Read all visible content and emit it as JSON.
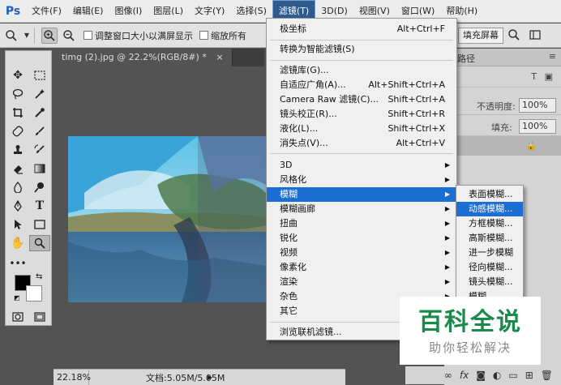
{
  "app": {
    "logo": "Ps"
  },
  "menubar": {
    "items": [
      "文件(F)",
      "编辑(E)",
      "图像(I)",
      "图层(L)",
      "文字(Y)",
      "选择(S)",
      "滤镜(T)",
      "3D(D)",
      "视图(V)",
      "窗口(W)",
      "帮助(H)"
    ],
    "active_index": 6
  },
  "options": {
    "resize_windows_label": "调整窗口大小以满屏显示",
    "zoom_all_label": "缩放所有",
    "fill_screen_label": "填充屏幕"
  },
  "document": {
    "tab_title": "timg (2).jpg @ 22.2%(RGB/8#) *",
    "tab_close": "×"
  },
  "status": {
    "zoom": "22.18%",
    "doc_size": "文档:5.05M/5.05M"
  },
  "right_panel": {
    "tab_label": "路径",
    "opacity_label": "不透明度:",
    "opacity_value": "100%",
    "fill_label": "填充:",
    "fill_value": "100%"
  },
  "filter_menu": {
    "items": [
      {
        "label": "极坐标",
        "shortcut": "Alt+Ctrl+F"
      },
      {
        "label": "转换为智能滤镜(S)",
        "shortcut": ""
      },
      {
        "label": "滤镜库(G)...",
        "shortcut": ""
      },
      {
        "label": "自适应广角(A)...",
        "shortcut": "Alt+Shift+Ctrl+A"
      },
      {
        "label": "Camera Raw 滤镜(C)...",
        "shortcut": "Shift+Ctrl+A"
      },
      {
        "label": "镜头校正(R)...",
        "shortcut": "Shift+Ctrl+R"
      },
      {
        "label": "液化(L)...",
        "shortcut": "Shift+Ctrl+X"
      },
      {
        "label": "消失点(V)...",
        "shortcut": "Alt+Ctrl+V"
      },
      {
        "label": "3D",
        "shortcut": ""
      },
      {
        "label": "风格化",
        "shortcut": ""
      },
      {
        "label": "模糊",
        "shortcut": ""
      },
      {
        "label": "模糊画廊",
        "shortcut": ""
      },
      {
        "label": "扭曲",
        "shortcut": ""
      },
      {
        "label": "锐化",
        "shortcut": ""
      },
      {
        "label": "视频",
        "shortcut": ""
      },
      {
        "label": "像素化",
        "shortcut": ""
      },
      {
        "label": "渲染",
        "shortcut": ""
      },
      {
        "label": "杂色",
        "shortcut": ""
      },
      {
        "label": "其它",
        "shortcut": ""
      },
      {
        "label": "浏览联机滤镜...",
        "shortcut": ""
      }
    ],
    "highlighted_index": 10,
    "submenu_arrow": "▶"
  },
  "blur_submenu": {
    "items": [
      "表面模糊...",
      "动感模糊...",
      "方框模糊...",
      "高斯模糊...",
      "进一步模糊",
      "径向模糊...",
      "镜头模糊...",
      "模糊"
    ],
    "highlighted_index": 1
  },
  "watermark": {
    "title": "百科全说",
    "subtitle": "助你轻松解决"
  },
  "colors": {
    "menu_highlight": "#1c6ed2",
    "watermark_green": "#1a8a4a"
  }
}
